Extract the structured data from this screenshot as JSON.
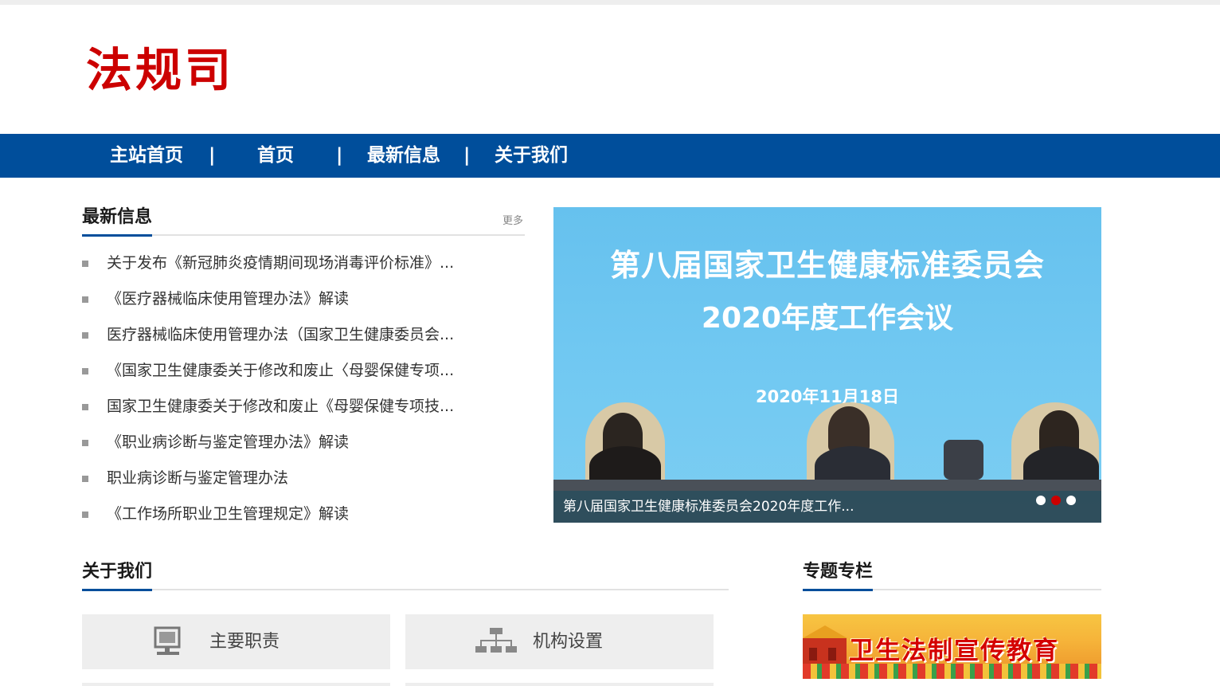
{
  "site": {
    "logo_text": "法规司"
  },
  "nav": {
    "items": [
      "主站首页",
      "首页",
      "最新信息",
      "关于我们"
    ],
    "separator": "|"
  },
  "news": {
    "title": "最新信息",
    "more": "更多",
    "items": [
      "关于发布《新冠肺炎疫情期间现场消毒评价标准》...",
      "《医疗器械临床使用管理办法》解读",
      "医疗器械临床使用管理办法（国家卫生健康委员会...",
      "《国家卫生健康委关于修改和废止〈母婴保健专项...",
      "国家卫生健康委关于修改和废止《母婴保健专项技...",
      "《职业病诊断与鉴定管理办法》解读",
      "职业病诊断与鉴定管理办法",
      "《工作场所职业卫生管理规定》解读"
    ]
  },
  "slider": {
    "headline": "第八届国家卫生健康标准委员会",
    "subheadline": "2020年度工作会议",
    "date": "2020年11月18日",
    "caption": "第八届国家卫生健康标准委员会2020年度工作...",
    "slide_count": 3,
    "active_index": 1
  },
  "about": {
    "title": "关于我们",
    "cards": [
      {
        "label": "主要职责",
        "icon": "monitor-icon"
      },
      {
        "label": "机构设置",
        "icon": "org-chart-icon"
      }
    ]
  },
  "topics": {
    "title": "专题专栏",
    "banner_text": "卫生法制宣传教育"
  },
  "colors": {
    "brand_blue": "#004e9b",
    "logo_red": "#cc0000",
    "slide_bg": "#6cc4f0"
  }
}
